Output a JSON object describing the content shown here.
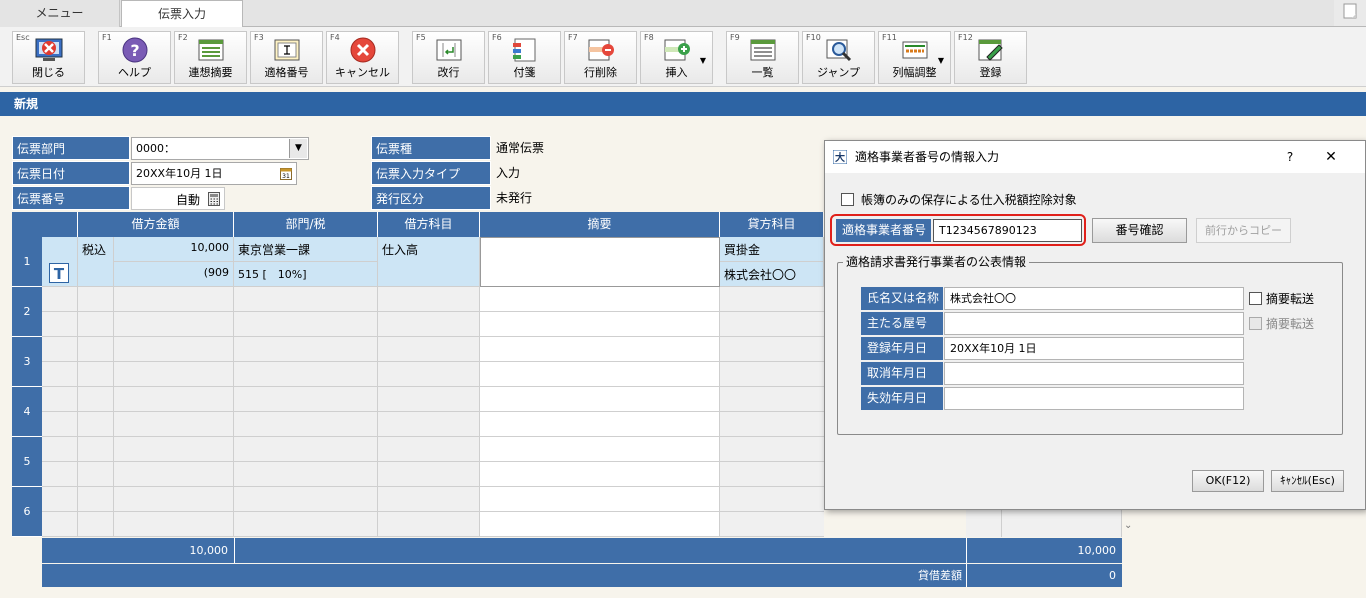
{
  "tabs": [
    {
      "label": "メニュー"
    },
    {
      "label": "伝票入力"
    }
  ],
  "toolbar": [
    {
      "key": "Esc",
      "label": "閉じる",
      "icon": "close-window-icon"
    },
    {
      "key": "F1",
      "label": "ヘルプ",
      "icon": "help-icon"
    },
    {
      "key": "F2",
      "label": "連想摘要",
      "icon": "list-icon"
    },
    {
      "key": "F3",
      "label": "適格番号",
      "icon": "text-cursor-icon"
    },
    {
      "key": "F4",
      "label": "キャンセル",
      "icon": "cancel-icon"
    },
    {
      "key": "F5",
      "label": "改行",
      "icon": "newline-icon"
    },
    {
      "key": "F6",
      "label": "付箋",
      "icon": "sticky-note-icon"
    },
    {
      "key": "F7",
      "label": "行削除",
      "icon": "delete-row-icon"
    },
    {
      "key": "F8",
      "label": "挿入",
      "icon": "insert-row-icon"
    },
    {
      "key": "F9",
      "label": "一覧",
      "icon": "list-view-icon"
    },
    {
      "key": "F10",
      "label": "ジャンプ",
      "icon": "magnifier-icon"
    },
    {
      "key": "F11",
      "label": "列幅調整",
      "icon": "column-width-icon"
    },
    {
      "key": "F12",
      "label": "登録",
      "icon": "register-icon"
    }
  ],
  "section_title": "新規",
  "header": {
    "dept_label": "伝票部門",
    "dept_value": "0000：",
    "date_label": "伝票日付",
    "date_value": "20XX年10月 1日",
    "number_label": "伝票番号",
    "number_value": "自動",
    "type_label": "伝票種",
    "type_value": "通常伝票",
    "input_type_label": "伝票入力タイプ",
    "input_type_value": "入力",
    "issue_label": "発行区分",
    "issue_value": "未発行"
  },
  "grid": {
    "columns": [
      "借方金額",
      "部門/税",
      "借方科目",
      "摘要",
      "貸方科目"
    ],
    "rows": [
      "1",
      "2",
      "3",
      "4",
      "5",
      "6"
    ],
    "row1": {
      "tax": "税込",
      "amount": "10,000",
      "sub_amount": "(909",
      "dept": "東京営業一課",
      "tax_code": "515 [　10%]",
      "debit": "仕入高",
      "credit": "買掛金",
      "partner": "株式会社〇〇"
    },
    "totals": {
      "debit_total": "10,000",
      "credit_total": "10,000",
      "diff_label": "貸借差額",
      "diff_value": "0"
    }
  },
  "dialog": {
    "title": "適格事業者番号の情報入力",
    "help": "?",
    "close": "✕",
    "checkbox_label": "帳簿のみの保存による仕入税額控除対象",
    "reg_label": "適格事業者番号",
    "reg_value": "T1234567890123",
    "confirm_btn": "番号確認",
    "copy_btn": "前行からコピー",
    "group_title": "適格請求書発行事業者の公表情報",
    "fields": [
      {
        "label": "氏名又は名称",
        "value": "株式会社〇〇"
      },
      {
        "label": "主たる屋号",
        "value": ""
      },
      {
        "label": "登録年月日",
        "value": "20XX年10月 1日"
      },
      {
        "label": "取消年月日",
        "value": ""
      },
      {
        "label": "失効年月日",
        "value": ""
      }
    ],
    "transfer1": "摘要転送",
    "transfer2": "摘要転送",
    "ok_btn": "OK(F12)",
    "cancel_btn": "ｷｬﾝｾﾙ(Esc)"
  }
}
